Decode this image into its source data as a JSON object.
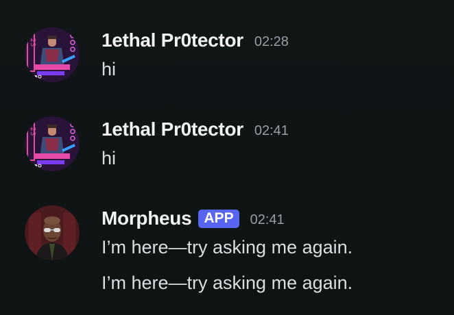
{
  "messages": [
    {
      "author": "1ethal Pr0tector",
      "avatar_icon": "cyberpunk-avatar-icon",
      "time": "02:28",
      "lines": [
        "hi"
      ]
    },
    {
      "author": "1ethal Pr0tector",
      "avatar_icon": "cyberpunk-avatar-icon",
      "time": "02:41",
      "lines": [
        "hi"
      ]
    },
    {
      "author": "Morpheus",
      "avatar_icon": "morpheus-avatar-icon",
      "badge": "APP",
      "time": "02:41",
      "lines": [
        "I’m here—try asking me again.",
        "I’m here—try asking me again."
      ]
    }
  ],
  "colors": {
    "background": "#0f1415",
    "username": "#f2f3f5",
    "timestamp": "#9a9da3",
    "message_text": "#dbdee1",
    "app_badge": "#5865f2"
  }
}
